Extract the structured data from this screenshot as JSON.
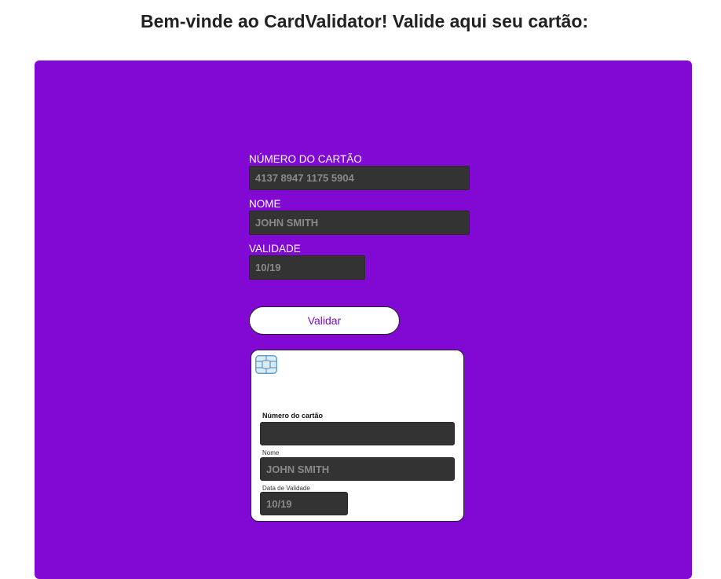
{
  "page": {
    "title": "Bem-vinde ao CardValidator! Valide aqui seu cartão:"
  },
  "form": {
    "card_number": {
      "label": "NÚMERO DO CARTÃO",
      "placeholder": "4137 8947 1175 5904",
      "value": ""
    },
    "name": {
      "label": "NOME",
      "placeholder": "JOHN SMITH",
      "value": ""
    },
    "expiry": {
      "label": "VALIDADE",
      "placeholder": "10/19",
      "value": ""
    },
    "validate_button": "Validar"
  },
  "card_preview": {
    "chip_icon": "sim-chip-icon",
    "number_label": "Número do cartão",
    "number_value": "",
    "name_label": "Nome",
    "name_placeholder": "JOHN SMITH",
    "expiry_label": "Data de Validade",
    "expiry_placeholder": "10/19"
  },
  "colors": {
    "panel_background": "#8209d4",
    "input_background": "#333333",
    "button_text": "#8209d4"
  }
}
